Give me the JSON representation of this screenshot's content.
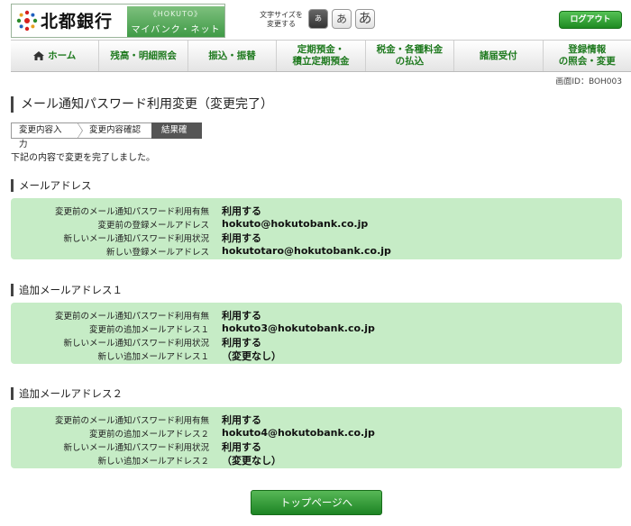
{
  "header": {
    "logo_name": "北都銀行",
    "logo_hokuto": "《HOKUTO》",
    "logo_sub": "マイバンク・ネット",
    "fontsize_label": "文字サイズを変更する",
    "fontsize_small": "あ",
    "fontsize_mid": "あ",
    "fontsize_large": "あ",
    "logout_label": "ログアウト"
  },
  "nav": {
    "items": [
      {
        "label": "ホーム"
      },
      {
        "label": "残高・明細照会"
      },
      {
        "label": "振込・振替"
      },
      {
        "label": "定期預金・\n積立定期預金"
      },
      {
        "label": "税金・各種料金\nの払込"
      },
      {
        "label": "諸届受付"
      },
      {
        "label": "登録情報\nの照会・変更"
      }
    ]
  },
  "screen_id": "画面ID：BOH003",
  "page_title": "メール通知パスワード利用変更（変更完了）",
  "steps": [
    "変更内容入力",
    "変更内容確認",
    "結果確認"
  ],
  "message": "下記の内容で変更を完了しました。",
  "sections": [
    {
      "title": "メールアドレス",
      "rows": [
        {
          "label": "変更前のメール通知パスワード利用有無",
          "value": "利用する"
        },
        {
          "label": "変更前の登録メールアドレス",
          "value": "hokuto@hokutobank.co.jp"
        },
        {
          "label": "新しいメール通知パスワード利用状況",
          "value": "利用する"
        },
        {
          "label": "新しい登録メールアドレス",
          "value": "hokutotaro@hokutobank.co.jp"
        }
      ]
    },
    {
      "title": "追加メールアドレス１",
      "rows": [
        {
          "label": "変更前のメール通知パスワード利用有無",
          "value": "利用する"
        },
        {
          "label": "変更前の追加メールアドレス１",
          "value": "hokuto3@hokutobank.co.jp"
        },
        {
          "label": "新しいメール通知パスワード利用状況",
          "value": "利用する"
        },
        {
          "label": "新しい追加メールアドレス１",
          "value": "（変更なし）"
        }
      ]
    },
    {
      "title": "追加メールアドレス２",
      "rows": [
        {
          "label": "変更前のメール通知パスワード利用有無",
          "value": "利用する"
        },
        {
          "label": "変更前の追加メールアドレス２",
          "value": "hokuto4@hokutobank.co.jp"
        },
        {
          "label": "新しいメール通知パスワード利用状況",
          "value": "利用する"
        },
        {
          "label": "新しい追加メールアドレス２",
          "value": "（変更なし）"
        }
      ]
    }
  ],
  "top_button_label": "トップページへ",
  "colors": {
    "brand_green": "#1f7a1f",
    "panel_green": "#c6ecc6",
    "button_green": "#2e9a33"
  }
}
